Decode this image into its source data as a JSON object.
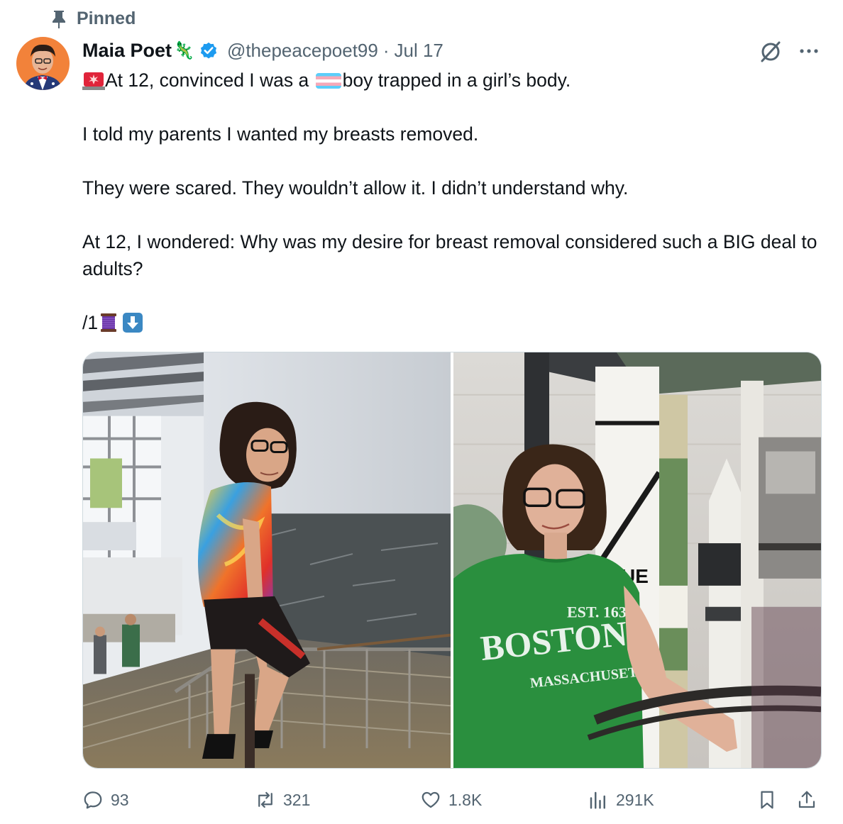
{
  "pinned_label": "Pinned",
  "author": {
    "name": "Maia Poet",
    "name_emoji": "🦎",
    "handle": "@thepeacepoet99",
    "separator": "·",
    "date": "Jul 17",
    "verified": true
  },
  "tweet": {
    "line1_emoji1": "🚨",
    "line1_part1": "At 12, convinced I was a ",
    "line1_emoji2": "🏳️‍⚧️",
    "line1_part2": "boy trapped in a girl’s body.",
    "line2": "I told my parents I wanted my breasts removed.",
    "line3": "They were scared. They wouldn’t allow it. I didn’t understand why.",
    "line4": "At 12, I wondered: Why was my desire for breast removal considered such a BIG deal to adults?",
    "line5_text": "/1",
    "line5_emoji1": "🧵",
    "line5_emoji2": "⬇️"
  },
  "media": {
    "left_photo": "photo-person-tie-dye-shirt-on-staircase",
    "right_photo": "photo-person-green-boston-shirt-museum",
    "shirt_text_est": "EST. 1630",
    "shirt_text_city": "BOSTON",
    "shirt_text_state": "MASSACHUSETTS",
    "banner_text": "UE"
  },
  "actions": {
    "replies": "93",
    "reposts": "321",
    "likes": "1.8K",
    "views": "291K"
  },
  "icons": {
    "pin": "pin-icon",
    "verified": "verified-badge-icon",
    "grok": "grok-icon",
    "more": "more-icon",
    "reply": "reply-icon",
    "repost": "repost-icon",
    "like": "like-icon",
    "views": "views-icon",
    "bookmark": "bookmark-icon",
    "share": "share-icon"
  },
  "colors": {
    "text_primary": "#0f1419",
    "text_secondary": "#536471",
    "verified_blue": "#1d9bf0",
    "border": "#cfd9de"
  }
}
